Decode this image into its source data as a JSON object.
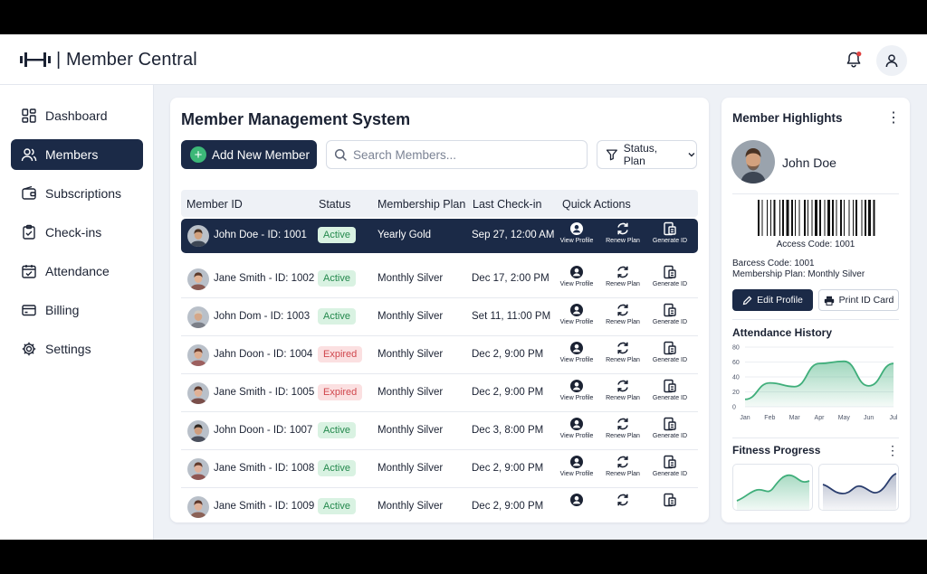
{
  "app": {
    "title": "Member Central",
    "separator": "|"
  },
  "sidebar": {
    "items": [
      {
        "label": "Dashboard",
        "icon": "grid-icon"
      },
      {
        "label": "Members",
        "icon": "users-icon",
        "active": true
      },
      {
        "label": "Subscriptions",
        "icon": "wallet-icon"
      },
      {
        "label": "Check-ins",
        "icon": "clipboard-check-icon"
      },
      {
        "label": "Attendance",
        "icon": "calendar-check-icon"
      },
      {
        "label": "Billing",
        "icon": "credit-card-icon"
      },
      {
        "label": "Settings",
        "icon": "gear-icon"
      }
    ]
  },
  "main": {
    "title": "Member Management System",
    "add_button": "Add New Member",
    "search_placeholder": "Search Members...",
    "filter_label": "Status, Plan",
    "columns": [
      "Member ID",
      "Status",
      "Membership Plan",
      "Last Check-in",
      "Quick Actions"
    ],
    "actions": [
      "View Profile",
      "Renew Plan",
      "Generate ID"
    ],
    "rows": [
      {
        "member": "John Doe - ID: 1001",
        "status": "Active",
        "plan": "Yearly Gold",
        "checkin": "Sep 27, 12:00 AM",
        "selected": true
      },
      {
        "member": "Jane Smith - ID: 1002",
        "status": "Active",
        "plan": "Monthly Silver",
        "checkin": "Dec 17, 2:00 PM"
      },
      {
        "member": "John Dom - ID: 1003",
        "status": "Active",
        "plan": "Monthly Silver",
        "checkin": "Set 11, 11:00 PM"
      },
      {
        "member": "Jahn Doon - ID: 1004",
        "status": "Expired",
        "plan": "Monthly Silver",
        "checkin": "Dec 2, 9:00 PM"
      },
      {
        "member": "Jane Smith - ID: 1005",
        "status": "Expired",
        "plan": "Monthly Silver",
        "checkin": "Dec 2, 9:00 PM"
      },
      {
        "member": "John Doon - ID: 1007",
        "status": "Active",
        "plan": "Monthly Silver",
        "checkin": "Dec 3, 8:00 PM"
      },
      {
        "member": "Jane Smith - ID: 1008",
        "status": "Active",
        "plan": "Monthly Silver",
        "checkin": "Dec 2, 9:00 PM"
      },
      {
        "member": "Jane Smith - ID: 1009",
        "status": "Active",
        "plan": "Monthly Silver",
        "checkin": "Dec 2, 9:00 PM"
      }
    ]
  },
  "highlights": {
    "title": "Member Highlights",
    "name": "John Doe",
    "access_code": "Access Code: 1001",
    "barcode_code": "Barcess Code: 1001",
    "membership_plan": "Membership Plan: Monthly Silver",
    "edit_button": "Edit Profile",
    "print_button": "Print ID Card",
    "attendance_title": "Attendance History",
    "fitness_title": "Fitness Progress"
  },
  "colors": {
    "navy": "#1b2a47",
    "green": "#3cb878",
    "active_bg": "#d9f2e2",
    "active_text": "#24894d",
    "expired_bg": "#fbe0e1",
    "expired_text": "#d0474d",
    "chart_green": "#3fae7a",
    "chart_navy": "#2a3d6e"
  },
  "chart_data": {
    "type": "area",
    "title": "Attendance History",
    "categories": [
      "Jan",
      "Feb",
      "Mar",
      "Apr",
      "May",
      "Jun",
      "Jul"
    ],
    "yticks": [
      0,
      20,
      40,
      60,
      80
    ],
    "ylim": [
      0,
      80
    ],
    "series": [
      {
        "values": [
          10,
          32,
          27,
          58,
          61,
          28,
          58
        ]
      }
    ],
    "grid": true
  }
}
